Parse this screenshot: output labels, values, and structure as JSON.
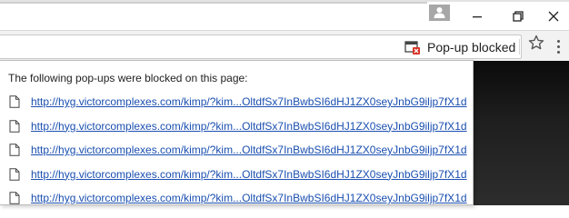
{
  "omnibox": {
    "blocked_chip_label": "Pop-up blocked"
  },
  "popup": {
    "message": "The following pop-ups were blocked on this page:",
    "items": [
      {
        "url": "http://hyg.victorcomplexes.com/kimp/?kim...OltdfSx7InBwbSI6dHJ1ZX0seyJnbG9iljp7fX1d"
      },
      {
        "url": "http://hyg.victorcomplexes.com/kimp/?kim...OltdfSx7InBwbSI6dHJ1ZX0seyJnbG9iljp7fX1d"
      },
      {
        "url": "http://hyg.victorcomplexes.com/kimp/?kim...OltdfSx7InBwbSI6dHJ1ZX0seyJnbG9iljp7fX1d"
      },
      {
        "url": "http://hyg.victorcomplexes.com/kimp/?kim...OltdfSx7InBwbSI6dHJ1ZX0seyJnbG9iljp7fX1d"
      },
      {
        "url": "http://hyg.victorcomplexes.com/kimp/?kim...OltdfSx7InBwbSI6dHJ1ZX0seyJnbG9iljp7fX1d"
      }
    ]
  },
  "icons": {
    "profile": "person-icon",
    "minimize": "minimize-icon",
    "restore": "restore-icon",
    "close": "close-icon",
    "popup_blocked": "popup-blocked-icon",
    "bookmark": "star-icon",
    "menu": "more-vert-icon",
    "page": "document-icon"
  },
  "colors": {
    "link": "#1a4fb0",
    "blocked_badge": "#d93025"
  }
}
